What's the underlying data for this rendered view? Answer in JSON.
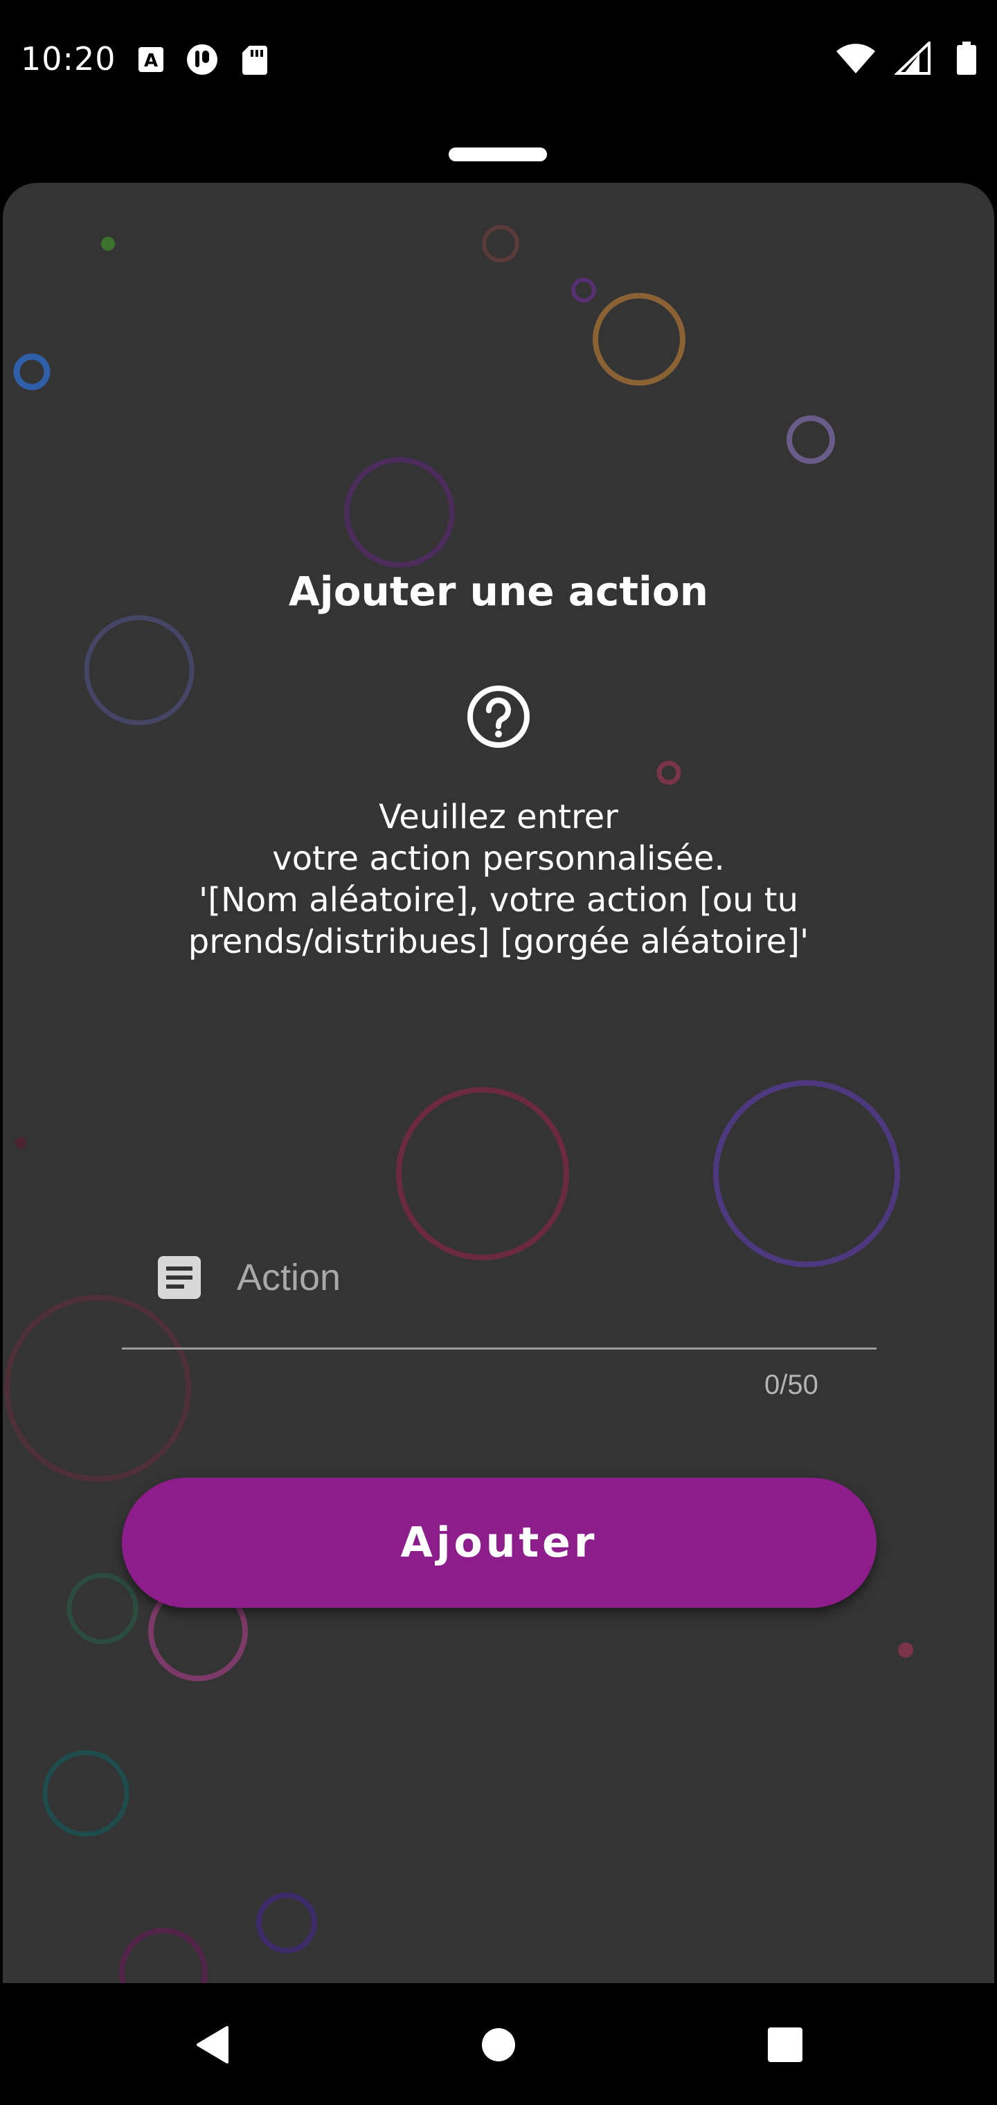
{
  "status_bar": {
    "time": "10:20",
    "left_icons": [
      "a-badge-icon",
      "notification-icon",
      "sd-card-icon"
    ],
    "right_icons": [
      "wifi-icon",
      "signal-icon",
      "battery-icon"
    ]
  },
  "dialog": {
    "title": "Ajouter une action",
    "instructions": [
      "Veuillez entrer",
      "votre action personnalisée.",
      "'[Nom aléatoire], votre action [ou tu",
      "prends/distribues] [gorgée aléatoire]'"
    ],
    "input": {
      "placeholder": "Action",
      "value": "",
      "counter": "0/50"
    },
    "submit_label": "Ajouter"
  },
  "colors": {
    "sheet_background": "#343434",
    "button": "#8e1d8c",
    "text": "#ffffff"
  },
  "nav_bar": {
    "buttons": [
      "back-icon",
      "home-icon",
      "recents-icon"
    ]
  }
}
